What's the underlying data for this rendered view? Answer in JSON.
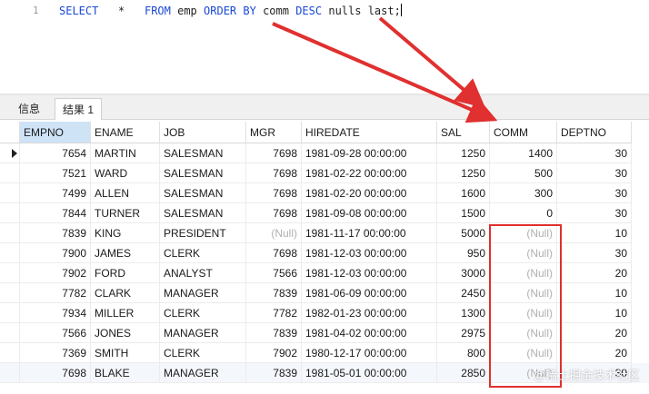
{
  "editor": {
    "line_number": "1",
    "tokens": {
      "select": "SELECT",
      "star": "*",
      "from": "FROM",
      "table": "emp",
      "order_by": "ORDER BY",
      "column": "comm",
      "desc": "DESC",
      "nulls_last": "nulls last;"
    }
  },
  "tabs": {
    "info": "信息",
    "result": "结果 1"
  },
  "grid": {
    "columns": [
      "EMPNO",
      "ENAME",
      "JOB",
      "MGR",
      "HIREDATE",
      "SAL",
      "COMM",
      "DEPTNO"
    ],
    "rows": [
      [
        "7654",
        "MARTIN",
        "SALESMAN",
        "7698",
        "1981-09-28 00:00:00",
        "1250",
        "1400",
        "30"
      ],
      [
        "7521",
        "WARD",
        "SALESMAN",
        "7698",
        "1981-02-22 00:00:00",
        "1250",
        "500",
        "30"
      ],
      [
        "7499",
        "ALLEN",
        "SALESMAN",
        "7698",
        "1981-02-20 00:00:00",
        "1600",
        "300",
        "30"
      ],
      [
        "7844",
        "TURNER",
        "SALESMAN",
        "7698",
        "1981-09-08 00:00:00",
        "1500",
        "0",
        "30"
      ],
      [
        "7839",
        "KING",
        "PRESIDENT",
        "(Null)",
        "1981-11-17 00:00:00",
        "5000",
        "(Null)",
        "10"
      ],
      [
        "7900",
        "JAMES",
        "CLERK",
        "7698",
        "1981-12-03 00:00:00",
        "950",
        "(Null)",
        "30"
      ],
      [
        "7902",
        "FORD",
        "ANALYST",
        "7566",
        "1981-12-03 00:00:00",
        "3000",
        "(Null)",
        "20"
      ],
      [
        "7782",
        "CLARK",
        "MANAGER",
        "7839",
        "1981-06-09 00:00:00",
        "2450",
        "(Null)",
        "10"
      ],
      [
        "7934",
        "MILLER",
        "CLERK",
        "7782",
        "1982-01-23 00:00:00",
        "1300",
        "(Null)",
        "10"
      ],
      [
        "7566",
        "JONES",
        "MANAGER",
        "7839",
        "1981-04-02 00:00:00",
        "2975",
        "(Null)",
        "20"
      ],
      [
        "7369",
        "SMITH",
        "CLERK",
        "7902",
        "1980-12-17 00:00:00",
        "800",
        "(Null)",
        "20"
      ],
      [
        "7698",
        "BLAKE",
        "MANAGER",
        "7839",
        "1981-05-01 00:00:00",
        "2850",
        "(Null)",
        "30"
      ]
    ]
  },
  "annotation": {
    "color": "#e0302f"
  },
  "watermark": "@稀土掘金技术社区"
}
